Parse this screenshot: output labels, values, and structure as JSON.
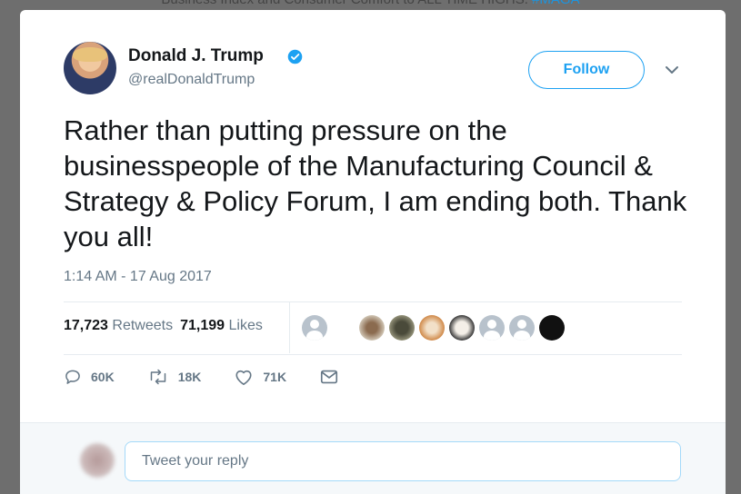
{
  "backdrop": {
    "text": "Business Index and Consumer Comfort to ALL TIME HIGHS.",
    "link": "#MAGA"
  },
  "tweet": {
    "author_name": "Donald J. Trump",
    "handle": "@realDonaldTrump",
    "follow_label": "Follow",
    "text": "Rather than putting pressure on the businesspeople of the Manufacturing Council & Strategy & Policy Forum, I am ending both. Thank you all!",
    "timestamp": "1:14 AM - 17 Aug 2017",
    "retweets_count": "17,723",
    "retweets_label": "Retweets",
    "likes_count": "71,199",
    "likes_label": "Likes",
    "actions": {
      "reply_count": "60K",
      "retweet_count": "18K",
      "like_count": "71K"
    }
  },
  "reply": {
    "placeholder": "Tweet your reply"
  },
  "colors": {
    "accent": "#1da1f2",
    "muted": "#657786",
    "text": "#14171a"
  },
  "icons": [
    "verified-badge-icon",
    "chevron-down-icon",
    "reply-icon",
    "retweet-icon",
    "heart-icon",
    "envelope-icon"
  ]
}
